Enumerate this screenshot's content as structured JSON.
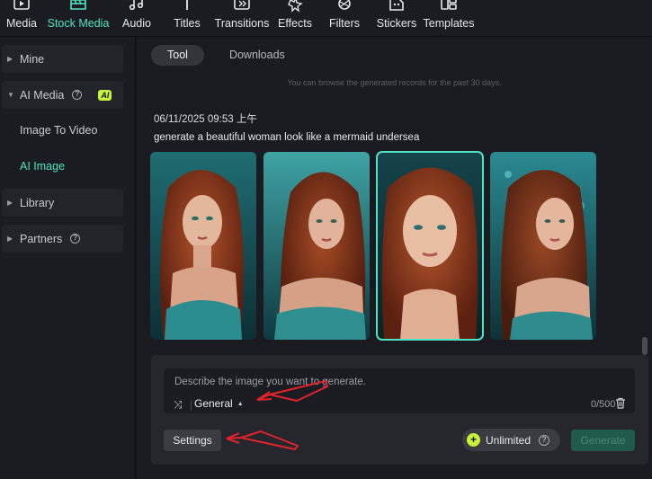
{
  "toolbar": {
    "items": [
      {
        "label": "Media",
        "icon": "media-icon"
      },
      {
        "label": "Stock Media",
        "icon": "stock-media-icon",
        "active": true
      },
      {
        "label": "Audio",
        "icon": "audio-icon"
      },
      {
        "label": "Titles",
        "icon": "titles-icon"
      },
      {
        "label": "Transitions",
        "icon": "transitions-icon"
      },
      {
        "label": "Effects",
        "icon": "effects-icon"
      },
      {
        "label": "Filters",
        "icon": "filters-icon"
      },
      {
        "label": "Stickers",
        "icon": "stickers-icon"
      },
      {
        "label": "Templates",
        "icon": "templates-icon"
      }
    ]
  },
  "sidebar": {
    "mine": "Mine",
    "ai_media": "AI Media",
    "ai_badge": "AI",
    "image_to_video": "Image To Video",
    "ai_image": "AI Image",
    "library": "Library",
    "partners": "Partners"
  },
  "main": {
    "tabs": [
      {
        "label": "Tool",
        "active": true
      },
      {
        "label": "Downloads"
      }
    ],
    "browse_note": "You can browse the generated records for the past 30 days.",
    "record": {
      "timestamp": "06/11/2025 09:53 上午",
      "prompt": "generate a beautiful woman look like a mermaid undersea",
      "selected_index": 2
    }
  },
  "input": {
    "placeholder": "Describe the image you want to generate.",
    "style": "General",
    "counter": "0/500",
    "settings_label": "Settings",
    "unlimited_label": "Unlimited",
    "generate_label": "Generate"
  },
  "colors": {
    "accent": "#4fe3c1",
    "badge": "#c8f33a",
    "annotation_arrow": "#e0232b"
  }
}
